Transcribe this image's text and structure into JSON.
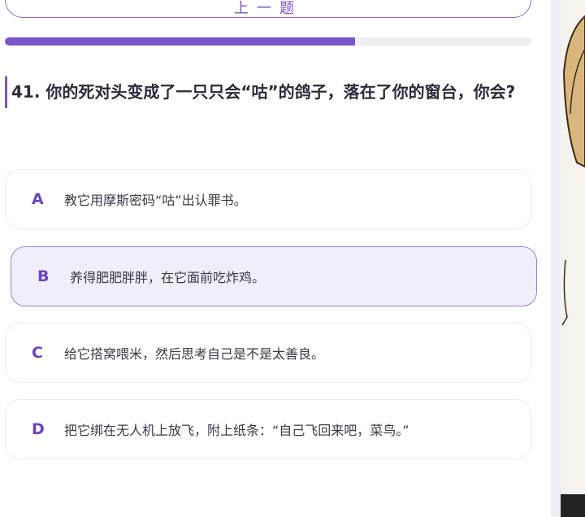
{
  "header": {
    "top_button_label": "上一题"
  },
  "progress": {
    "fraction": 0.665
  },
  "question": {
    "text": "41. 你的死对头变成了一只只会“咕”的鸽子，落在了你的窗台，你会?"
  },
  "options": [
    {
      "letter": "A",
      "text": "教它用摩斯密码“咕”出认罪书。"
    },
    {
      "letter": "B",
      "text": "养得肥肥胖胖，在它面前吃炸鸡。"
    },
    {
      "letter": "C",
      "text": "给它搭窝喂米，然后思考自己是不是太善良。"
    },
    {
      "letter": "D",
      "text": "把它绑在无人机上放飞，附上纸条：“自己飞回来吧，菜鸟。”"
    }
  ],
  "selected_option": "B",
  "colors": {
    "accent": "#7a56c8",
    "selected_bg": "#f2eefb"
  }
}
